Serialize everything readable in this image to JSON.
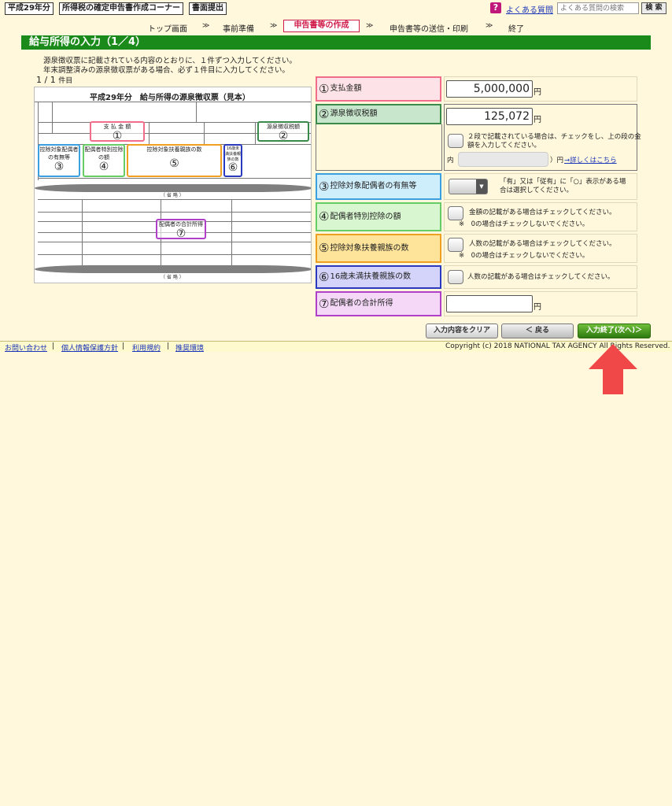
{
  "header": {
    "year_tag": "平成29年分",
    "corner_tag": "所得税の確定申告書作成コーナー",
    "paper_tag": "書面提出",
    "faq_icon": "question-icon",
    "faq_link": "よくある質問",
    "search_placeholder": "よくある質問の検索",
    "search_button": "検 索"
  },
  "nav": {
    "items": [
      "トップ画面",
      "事前準備",
      "申告書等の作成",
      "申告書等の送信・印刷",
      "終了"
    ],
    "separator": "≫",
    "active_index": 2
  },
  "page": {
    "title": "給与所得の入力（1／4）",
    "instruction_1": "源泉徴収票に記載されている内容のとおりに、１件ずつ入力してください。",
    "instruction_2": "年末調整済みの源泉徴収票がある場合、必ず１件目に入力してください。",
    "count_main": "1 / 1",
    "count_unit": "件目"
  },
  "sample": {
    "title": "平成29年分　給与所得の源泉徴収票（見本）",
    "callout_1": "支 払 金 額",
    "callout_2": "源泉徴収税額",
    "callout_3": "控除対象配偶者の有無等",
    "callout_4": "配偶者特別控除の額",
    "callout_5": "控除対象扶養親族の数",
    "callout_6": "16歳未満扶養親族の数",
    "callout_7": "配偶者の合計所得",
    "omitted": "（ 省 略 ）",
    "nums": [
      "①",
      "②",
      "③",
      "④",
      "⑤",
      "⑥",
      "⑦"
    ]
  },
  "form": {
    "rows": [
      {
        "num": "①",
        "label": "支払金額",
        "color": "#f26d8a",
        "bg": "#fde3e8"
      },
      {
        "num": "②",
        "label": "源泉徴収税額",
        "color": "#3a8a4a",
        "bg": "#c8e6cc"
      },
      {
        "num": "③",
        "label": "控除対象配偶者の有無等",
        "color": "#3aa0e0",
        "bg": "#cfeefc"
      },
      {
        "num": "④",
        "label": "配偶者特別控除の額",
        "color": "#66cc66",
        "bg": "#d8f7d0"
      },
      {
        "num": "⑤",
        "label": "控除対象扶養親族の数",
        "color": "#f0a020",
        "bg": "#fde49a"
      },
      {
        "num": "⑥",
        "label": "16歳未満扶養親族の数",
        "color": "#2a3ac0",
        "bg": "#d4d4fa"
      },
      {
        "num": "⑦",
        "label": "配偶者の合計所得",
        "color": "#b040c8",
        "bg": "#f5d8f8"
      }
    ],
    "payment_amount": "5,000,000",
    "withholding_tax": "125,072",
    "yen": "円",
    "two_tier_note_1": "２段で記載されている場合は、チェックをし、上の段の金",
    "two_tier_note_2": "額を入力してください。",
    "inner_label": "内（",
    "inner_suffix": "）円",
    "detail_link": "→詳しくはこちら",
    "spouse_note_1": "「有」又は「従有」に「○」表示がある場",
    "spouse_note_2": "合は選択してください。",
    "special_note": "金額の記載がある場合はチェックしてください。",
    "zero_note": "※　0の場合はチェックしないでください。",
    "dependents_note": "人数の記載がある場合はチェックしてください。",
    "under16_note": "人数の記載がある場合はチェックしてください。",
    "spouse_income_value": ""
  },
  "buttons": {
    "clear": "入力内容をクリア",
    "back": "＜ 戻る",
    "next": "入力終了(次へ)＞"
  },
  "footer": {
    "links": [
      "お問い合わせ",
      "個人情報保護方針",
      "利用規約",
      "推奨環境"
    ],
    "copyright": "Copyright (c) 2018 NATIONAL TAX AGENCY All Rights Reserved."
  },
  "colors": {
    "title_green": "#1a8a1a",
    "nav_active": "#d01c4b",
    "next_button": "#3f8f1a",
    "arrow_red": "#f04848"
  }
}
